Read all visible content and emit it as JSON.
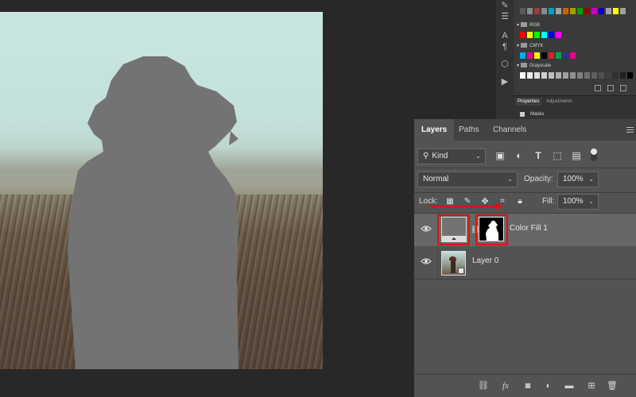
{
  "swatches": {
    "top_row": [
      "#5a5a5a",
      "#8a8a8a",
      "#a03a3a",
      "#8a8a8a",
      "#00a0c8",
      "#a0a0a0",
      "#c86400",
      "#a0a000",
      "#00a000",
      "#a00000",
      "#c800c8",
      "#0000c8",
      "#a0a0a0",
      "#ffff00",
      "#a0a0a0"
    ],
    "groups": [
      {
        "label": "RGB",
        "colors": [
          "#ff0000",
          "#ffff00",
          "#00ff00",
          "#00ffff",
          "#0000ff",
          "#ff00ff"
        ]
      },
      {
        "label": "CMYK",
        "colors": [
          "#00aeef",
          "#ec008c",
          "#fff200",
          "#000000",
          "#ed1c24",
          "#00a651",
          "#2e3192",
          "#ec008c"
        ]
      },
      {
        "label": "Grayscale",
        "colors": [
          "#ffffff",
          "#f0f0f0",
          "#e0e0e0",
          "#d0d0d0",
          "#c0c0c0",
          "#b0b0b0",
          "#a0a0a0",
          "#909090",
          "#808080",
          "#707070",
          "#606060",
          "#505050",
          "#404040",
          "#303030",
          "#202020",
          "#000000"
        ]
      }
    ]
  },
  "properties": {
    "tabs": [
      "Properties",
      "Adjustments"
    ],
    "section": "Masks"
  },
  "layers_panel": {
    "tabs": [
      "Layers",
      "Paths",
      "Channels"
    ],
    "filter_kind": "Kind",
    "blend_mode": "Normal",
    "opacity_label": "Opacity:",
    "opacity_value": "100%",
    "lock_label": "Lock:",
    "fill_label": "Fill:",
    "fill_value": "100%",
    "layers": [
      {
        "name": "Color Fill 1",
        "selected": true
      },
      {
        "name": "Layer 0",
        "selected": false
      }
    ]
  },
  "colors": {
    "highlight_red": "#e01010",
    "fill_gray": "#737373"
  }
}
